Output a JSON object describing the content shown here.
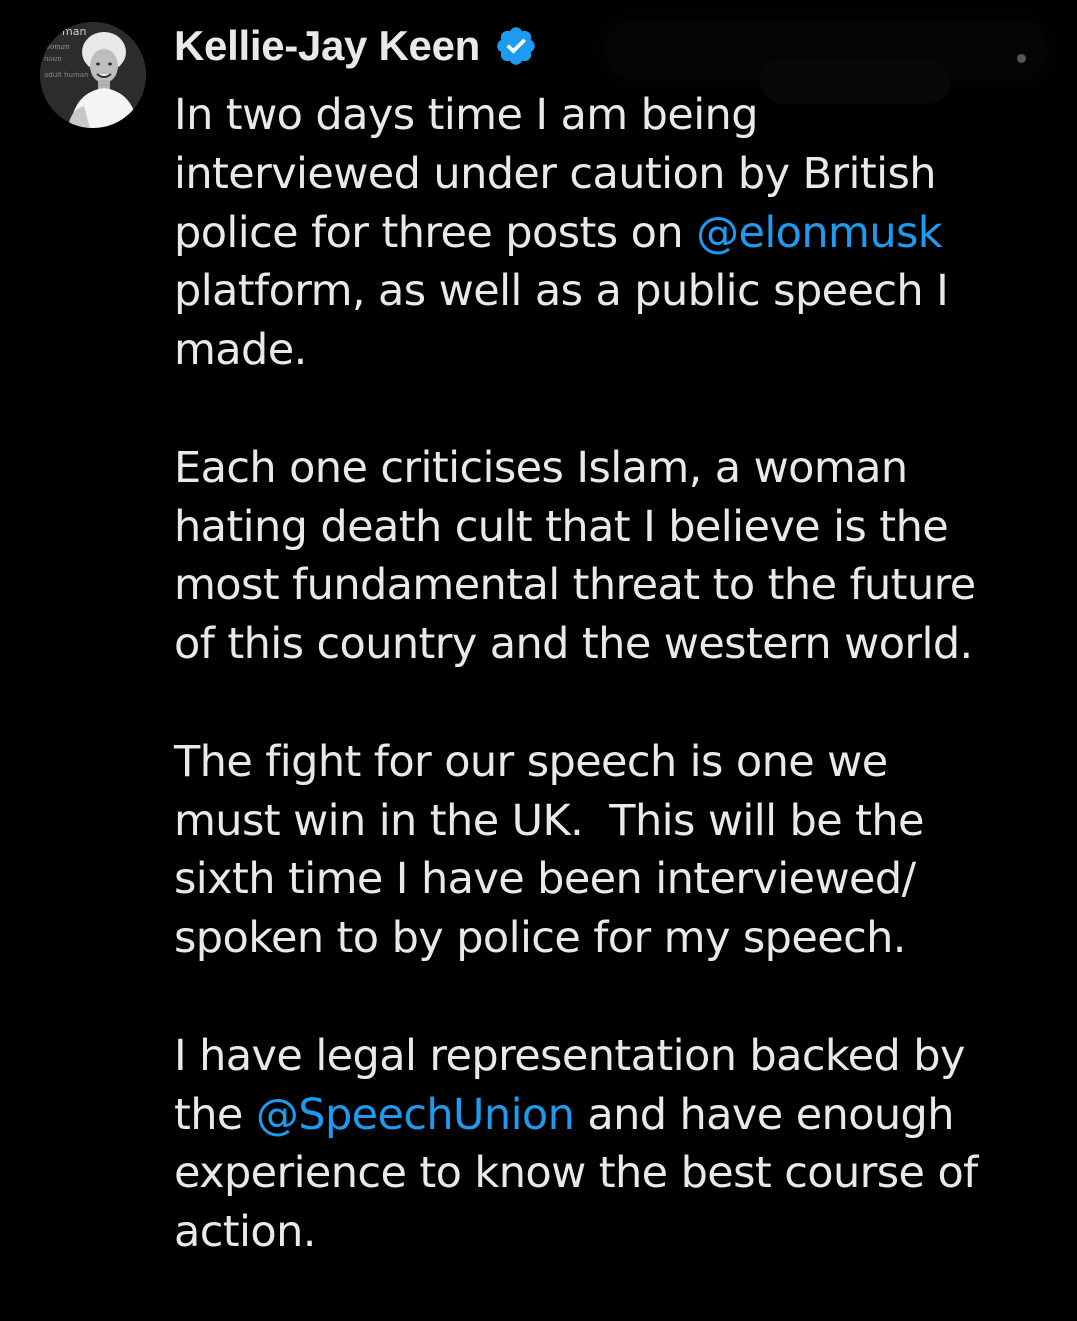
{
  "post": {
    "author": {
      "display_name": "Kellie-Jay Keen",
      "verified": true,
      "avatar_icon": "profile-photo",
      "avatar_caption_words": [
        "man",
        "woman",
        "noun",
        "adult human"
      ]
    },
    "paragraphs": [
      {
        "lines": [
          [
            {
              "text": "In two days time I am being"
            }
          ],
          [
            {
              "text": "interviewed under caution by British"
            }
          ],
          [
            {
              "text": "police for three posts on "
            },
            {
              "text": "@elonmusk",
              "mention": true
            }
          ],
          [
            {
              "text": "platform, as well as a public speech I"
            }
          ],
          [
            {
              "text": "made."
            }
          ]
        ]
      },
      {
        "lines": [
          [
            {
              "text": "Each one criticises Islam, a woman"
            }
          ],
          [
            {
              "text": "hating death cult that I believe is the"
            }
          ],
          [
            {
              "text": "most fundamental threat to the future"
            }
          ],
          [
            {
              "text": "of this country and the western world."
            }
          ]
        ]
      },
      {
        "lines": [
          [
            {
              "text": "The fight for our speech is one we"
            }
          ],
          [
            {
              "text": "must win in the UK.  This will be the"
            }
          ],
          [
            {
              "text": "sixth time I have been interviewed/"
            }
          ],
          [
            {
              "text": "spoken to by police for my speech."
            }
          ]
        ]
      },
      {
        "lines": [
          [
            {
              "text": "I have legal representation backed by"
            }
          ],
          [
            {
              "text": "the "
            },
            {
              "text": "@SpeechUnion",
              "mention": true
            },
            {
              "text": " and have enough"
            }
          ],
          [
            {
              "text": "experience to know the best course of"
            }
          ],
          [
            {
              "text": "action."
            }
          ]
        ]
      }
    ]
  },
  "colors": {
    "background": "#000000",
    "text": "#e7e9ea",
    "mention": "#1d9bf0",
    "verified_badge": "#1d9bf0"
  }
}
